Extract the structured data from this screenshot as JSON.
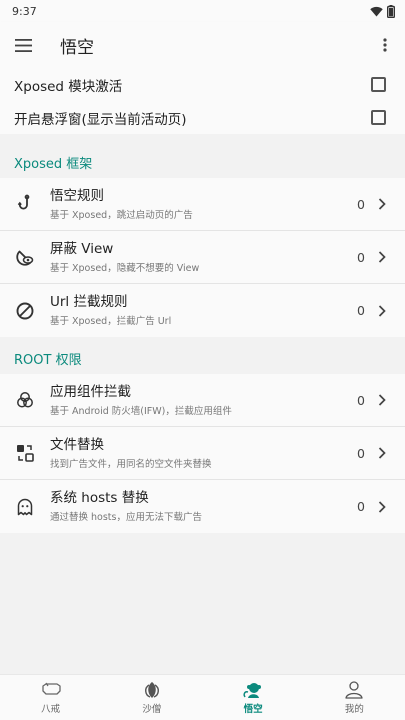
{
  "status_bar": {
    "time": "9:37"
  },
  "app_bar": {
    "title": "悟空"
  },
  "switches": [
    {
      "label": "Xposed 模块激活",
      "checked": false
    },
    {
      "label": "开启悬浮窗(显示当前活动页)",
      "checked": false
    }
  ],
  "sections": [
    {
      "title": "Xposed 框架",
      "items": [
        {
          "title": "悟空规则",
          "subtitle": "基于 Xposed，跳过启动页的广告",
          "count": "0",
          "icon": "hook-icon"
        },
        {
          "title": "屏蔽 View",
          "subtitle": "基于 Xposed，隐藏不想要的 View",
          "count": "0",
          "icon": "eye-block-icon"
        },
        {
          "title": "Url 拦截规则",
          "subtitle": "基于 Xposed，拦截广告 Url",
          "count": "0",
          "icon": "block-icon"
        }
      ]
    },
    {
      "title": "ROOT 权限",
      "items": [
        {
          "title": "应用组件拦截",
          "subtitle": "基于 Android 防火墙(IFW)，拦截应用组件",
          "count": "0",
          "icon": "circles-icon"
        },
        {
          "title": "文件替换",
          "subtitle": "找到广告文件，用同名的空文件夹替换",
          "count": "0",
          "icon": "swap-icon"
        },
        {
          "title": "系统 hosts 替换",
          "subtitle": "通过替换 hosts，应用无法下载广告",
          "count": "0",
          "icon": "ghost-icon"
        }
      ]
    }
  ],
  "bottom_nav": [
    {
      "label": "八戒",
      "icon": "pig-icon",
      "active": false
    },
    {
      "label": "沙僧",
      "icon": "leaf-icon",
      "active": false
    },
    {
      "label": "悟空",
      "icon": "monkey-icon",
      "active": true
    },
    {
      "label": "我的",
      "icon": "person-icon",
      "active": false
    }
  ],
  "colors": {
    "accent": "#0b8a7d",
    "background": "#f2f2f2",
    "card": "#fafafa"
  }
}
